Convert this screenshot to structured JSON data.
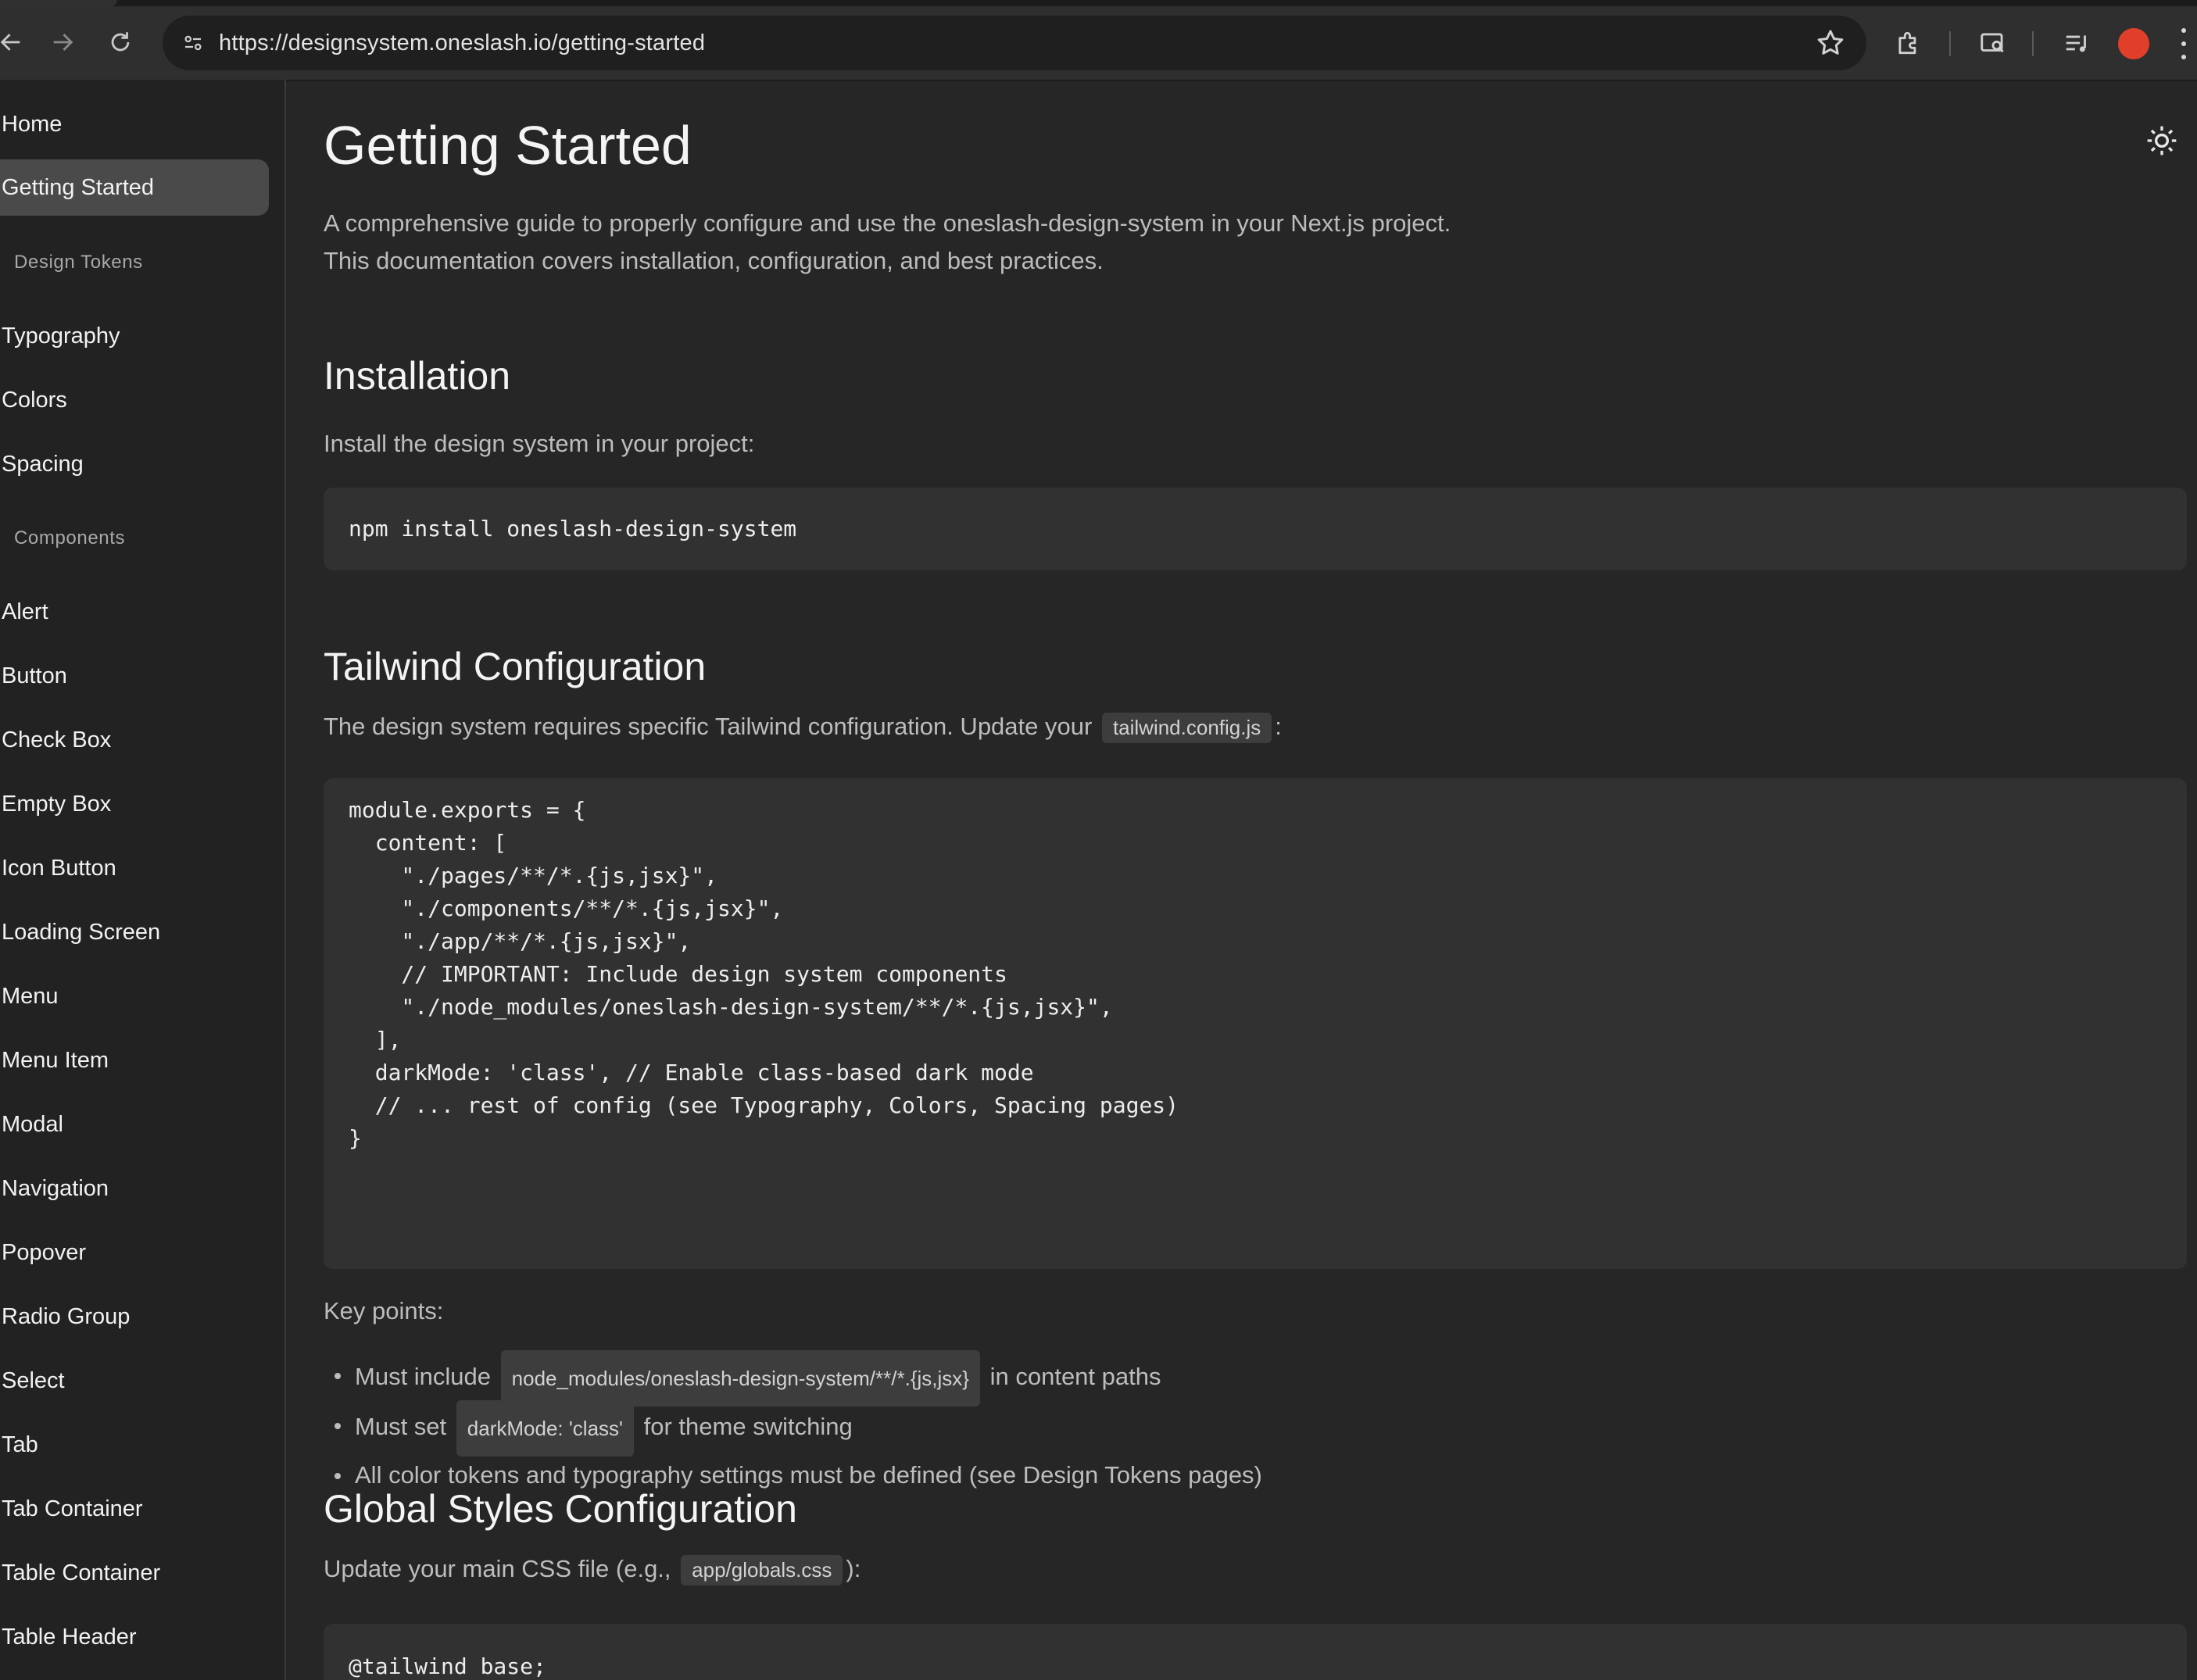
{
  "browser": {
    "url": "https://designsystem.oneslash.io/getting-started"
  },
  "sidebar": {
    "items": [
      {
        "label": "Home"
      },
      {
        "label": "Getting Started",
        "active": true
      }
    ],
    "sections": [
      {
        "title": "Design Tokens",
        "items": [
          "Typography",
          "Colors",
          "Spacing"
        ]
      },
      {
        "title": "Components",
        "items": [
          "Alert",
          "Button",
          "Check Box",
          "Empty Box",
          "Icon Button",
          "Loading Screen",
          "Menu",
          "Menu Item",
          "Modal",
          "Navigation",
          "Popover",
          "Radio Group",
          "Select",
          "Tab",
          "Tab Container",
          "Table Container",
          "Table Header"
        ]
      }
    ]
  },
  "main": {
    "title": "Getting Started",
    "lead": "A comprehensive guide to properly configure and use the oneslash-design-system in your Next.js project. This documentation covers installation, configuration, and best practices.",
    "installation": {
      "heading": "Installation",
      "text": "Install the design system in your project:",
      "code": "npm install oneslash-design-system"
    },
    "tailwind": {
      "heading": "Tailwind Configuration",
      "text_before": "The design system requires specific Tailwind configuration. Update your",
      "inline_code": "tailwind.config.js",
      "text_after": ":",
      "code": "module.exports = {\n  content: [\n    \"./pages/**/*.{js,jsx}\",\n    \"./components/**/*.{js,jsx}\",\n    \"./app/**/*.{js,jsx}\",\n    // IMPORTANT: Include design system components\n    \"./node_modules/oneslash-design-system/**/*.{js,jsx}\",\n  ],\n  darkMode: 'class', // Enable class-based dark mode\n  // ... rest of config (see Typography, Colors, Spacing pages)\n}",
      "key_points_label": "Key points:",
      "key_points": [
        {
          "before": "Must include",
          "code": "node_modules/oneslash-design-system/**/*.{js,jsx}",
          "after": "in content paths"
        },
        {
          "before": "Must set",
          "code": "darkMode: 'class'",
          "after": "for theme switching"
        },
        {
          "before": "All color tokens and typography settings must be defined (see Design Tokens pages)",
          "code": "",
          "after": ""
        }
      ]
    },
    "global_styles": {
      "heading": "Global Styles Configuration",
      "text_before": "Update your main CSS file (e.g.,",
      "inline_code": "app/globals.css",
      "text_after": "):",
      "code": "@tailwind base;"
    }
  },
  "icons": [
    "back-arrow-icon",
    "forward-arrow-icon",
    "reload-icon",
    "site-settings-icon",
    "bookmark-star-icon",
    "extensions-icon",
    "tab-search-icon",
    "media-control-icon",
    "more-vert-icon",
    "sun-icon"
  ],
  "colors": {
    "background": "#262626",
    "sidebar": "#222222",
    "active_item": "#4a4a4a",
    "code_bg": "#313131",
    "profile": "#e0402a"
  }
}
